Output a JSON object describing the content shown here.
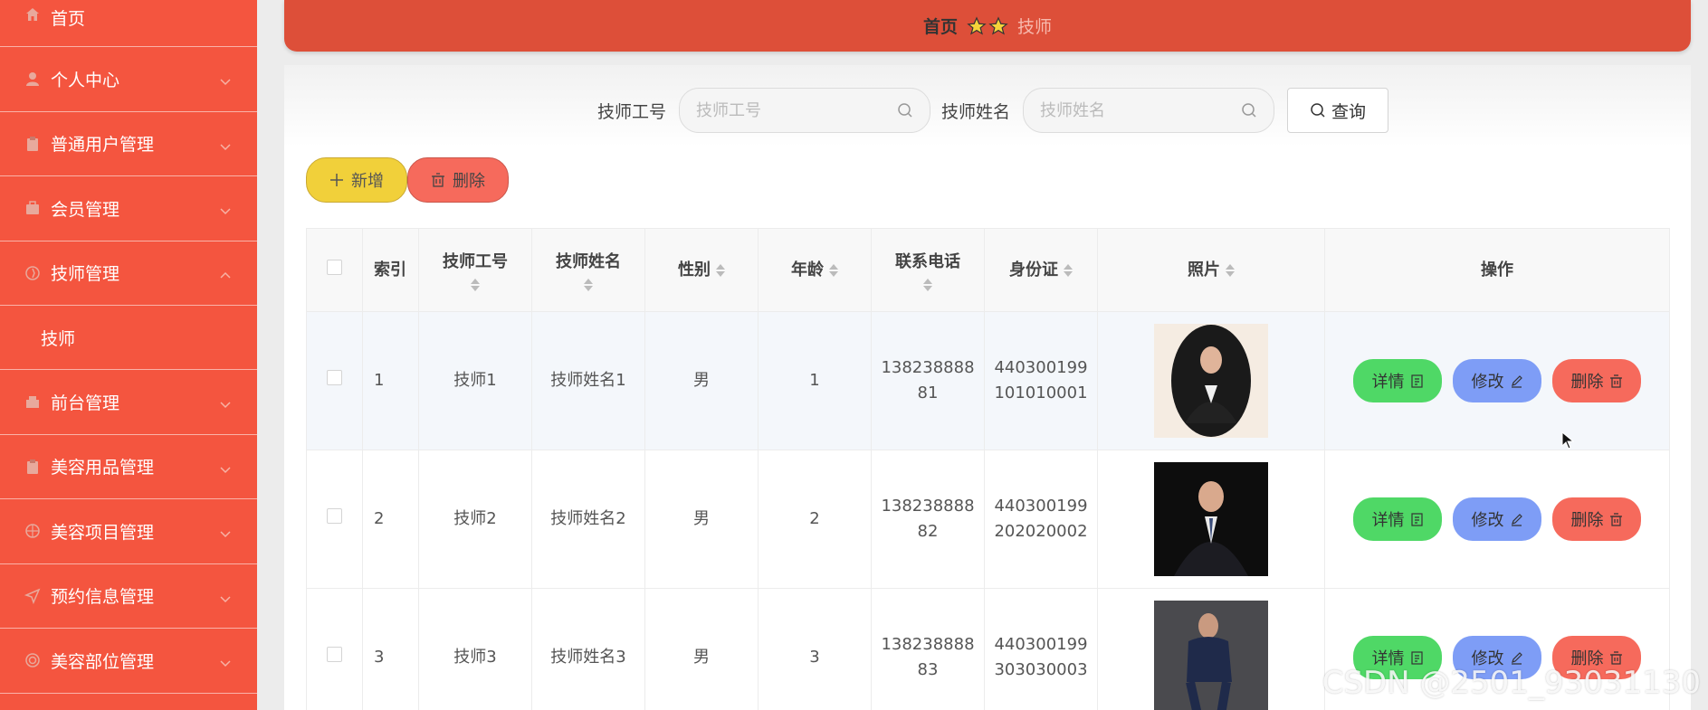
{
  "sidebar": {
    "items": [
      {
        "label": "首页"
      },
      {
        "label": "个人中心"
      },
      {
        "label": "普通用户管理"
      },
      {
        "label": "会员管理"
      },
      {
        "label": "技师管理"
      },
      {
        "label": "技师"
      },
      {
        "label": "前台管理"
      },
      {
        "label": "美容用品管理"
      },
      {
        "label": "美容项目管理"
      },
      {
        "label": "预约信息管理"
      },
      {
        "label": "美容部位管理"
      }
    ]
  },
  "breadcrumb": {
    "home": "首页",
    "current": "技师"
  },
  "search": {
    "id_label": "技师工号",
    "id_placeholder": "技师工号",
    "name_label": "技师姓名",
    "name_placeholder": "技师姓名",
    "query_label": "查询"
  },
  "actions": {
    "add_label": "新增",
    "delete_label": "删除"
  },
  "table": {
    "headers": {
      "index": "索引",
      "tech_id": "技师工号",
      "tech_name": "技师姓名",
      "gender": "性别",
      "age": "年龄",
      "phone": "联系电话",
      "idcard": "身份证",
      "photo": "照片",
      "ops": "操作"
    },
    "rows": [
      {
        "index": "1",
        "tech_id": "技师1",
        "tech_name": "技师姓名1",
        "gender": "男",
        "age": "1",
        "phone_a": "138238888",
        "phone_b": "81",
        "id_a": "440300199",
        "id_b": "101010001"
      },
      {
        "index": "2",
        "tech_id": "技师2",
        "tech_name": "技师姓名2",
        "gender": "男",
        "age": "2",
        "phone_a": "138238888",
        "phone_b": "82",
        "id_a": "440300199",
        "id_b": "202020002"
      },
      {
        "index": "3",
        "tech_id": "技师3",
        "tech_name": "技师姓名3",
        "gender": "男",
        "age": "3",
        "phone_a": "138238888",
        "phone_b": "83",
        "id_a": "440300199",
        "id_b": "303030003"
      }
    ],
    "op_labels": {
      "detail": "详情",
      "edit": "修改",
      "delete": "删除"
    }
  },
  "watermark": "CSDN @2501_93031130",
  "colors": {
    "sidebar": "#f4553f",
    "header": "#dd4f39",
    "detail": "#4fd866",
    "edit": "#7e9df6",
    "delete": "#f66a5c",
    "add": "#f1d03a"
  }
}
